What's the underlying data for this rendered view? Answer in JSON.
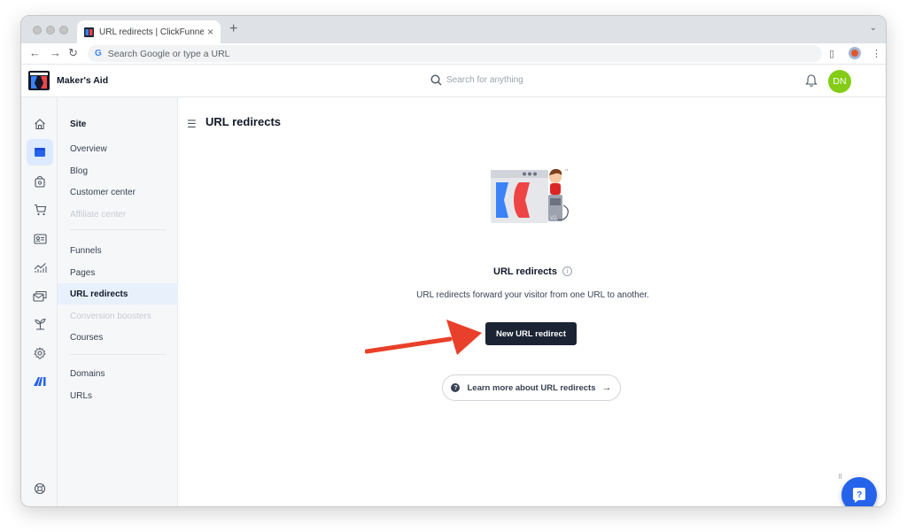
{
  "browser": {
    "tab_title": "URL redirects | ClickFunnels",
    "tab_close": "×",
    "new_tab": "+",
    "address_placeholder": "Search Google or type a URL"
  },
  "header": {
    "workspace_name": "Maker's Aid",
    "search_placeholder": "Search for anything",
    "avatar_initials": "DN"
  },
  "subnav": {
    "section_title": "Site",
    "group1": [
      {
        "label": "Overview",
        "disabled": false
      },
      {
        "label": "Blog",
        "disabled": false
      },
      {
        "label": "Customer center",
        "disabled": false
      },
      {
        "label": "Affiliate center",
        "disabled": true
      }
    ],
    "group2": [
      {
        "label": "Funnels",
        "disabled": false
      },
      {
        "label": "Pages",
        "disabled": false
      },
      {
        "label": "URL redirects",
        "disabled": false,
        "active": true
      },
      {
        "label": "Conversion boosters",
        "disabled": true
      },
      {
        "label": "Courses",
        "disabled": false
      }
    ],
    "group3": [
      {
        "label": "Domains",
        "disabled": false
      },
      {
        "label": "URLs",
        "disabled": false
      }
    ]
  },
  "main": {
    "page_title": "URL redirects",
    "empty_title": "URL redirects",
    "info_symbol": "i",
    "empty_description": "URL redirects forward your visitor from one URL to another.",
    "new_button": "New URL redirect",
    "learn_more": "Learn more about URL redirects",
    "learn_more_arrow": "→",
    "learn_more_q": "?"
  },
  "colors": {
    "primary_button": "#1c2433",
    "active_nav_bg": "#e8f0fc",
    "avatar_bg": "#84cc16",
    "help_fab": "#2563eb",
    "annotation_arrow": "#e8402a"
  },
  "icons": [
    "home-icon",
    "site-icon",
    "store-icon",
    "cart-icon",
    "contacts-icon",
    "analytics-icon",
    "email-icon",
    "automation-icon",
    "settings-icon",
    "ai-icon",
    "help-ring-icon",
    "search-icon",
    "bell-icon",
    "menu-icon"
  ]
}
